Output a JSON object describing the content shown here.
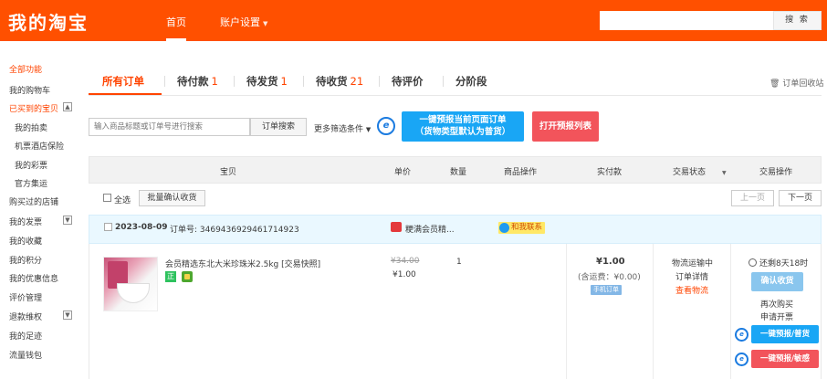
{
  "header": {
    "logo": "我的淘宝",
    "nav_home": "首页",
    "nav_account": "账户设置",
    "search_button": "搜 索",
    "brand_color": "#ff5000"
  },
  "sidebar": {
    "all_functions": "全部功能",
    "items": [
      {
        "label": "我的购物车"
      },
      {
        "label": "已买到的宝贝",
        "toggle": "▲"
      },
      {
        "label": "我的拍卖"
      },
      {
        "label": "机票酒店保险"
      },
      {
        "label": "我的彩票"
      },
      {
        "label": "官方集运"
      },
      {
        "label": "购买过的店铺"
      },
      {
        "label": "我的发票",
        "toggle": "▼"
      },
      {
        "label": "我的收藏"
      },
      {
        "label": "我的积分"
      },
      {
        "label": "我的优惠信息"
      },
      {
        "label": "评价管理"
      },
      {
        "label": "退款维权",
        "toggle": "▼"
      },
      {
        "label": "我的足迹"
      },
      {
        "label": "流量钱包"
      }
    ]
  },
  "tabs": [
    {
      "label": "所有订单",
      "count": ""
    },
    {
      "label": "待付款",
      "count": "1"
    },
    {
      "label": "待发货",
      "count": "1"
    },
    {
      "label": "待收货",
      "count": "21"
    },
    {
      "label": "待评价",
      "count": ""
    },
    {
      "label": "分阶段",
      "count": ""
    }
  ],
  "recycle_bin": "订单回收站",
  "filter": {
    "placeholder": "输入商品标题或订单号进行搜索",
    "search_button": "订单搜索",
    "more": "更多筛选条件",
    "blue_button_line1": "一键预报当前页面订单",
    "blue_button_line2": "（货物类型默认为普货）",
    "red_button": "打开预报列表"
  },
  "table_header": {
    "item": "宝贝",
    "price": "单价",
    "quantity": "数量",
    "item_ops": "商品操作",
    "paid": "实付款",
    "status": "交易状态",
    "ops": "交易操作"
  },
  "select_row": {
    "select_all": "全选",
    "batch_confirm": "批量确认收货",
    "prev": "上一页",
    "next": "下一页"
  },
  "order": {
    "date": "2023-08-09",
    "order_number": "订单号: 3469436929461714923",
    "shop": "粳满会员精...",
    "contact": "和我联系",
    "product_title": "会员精选东北大米珍珠米2.5kg [交易快照]",
    "badge_text": "正",
    "original_price": "¥34.00",
    "price": "¥1.00",
    "quantity": "1",
    "paid": "¥1.00",
    "shipping": "(含运费：¥0.00)",
    "pay_tag": "手机订单",
    "status_1": "物流运输中",
    "status_2": "订单详情",
    "status_3": "查看物流",
    "timer": "还剩8天18时",
    "confirm": "确认收货",
    "buy_again": "再次购买",
    "invoice": "申请开票",
    "action_blue": "一键预报/普货",
    "action_red": "一键预报/敏感"
  },
  "colors": {
    "accent": "#ff4400",
    "blue_button": "#19a6f5",
    "red_button": "#f2545b",
    "order_header_bg": "#eaf8ff"
  }
}
